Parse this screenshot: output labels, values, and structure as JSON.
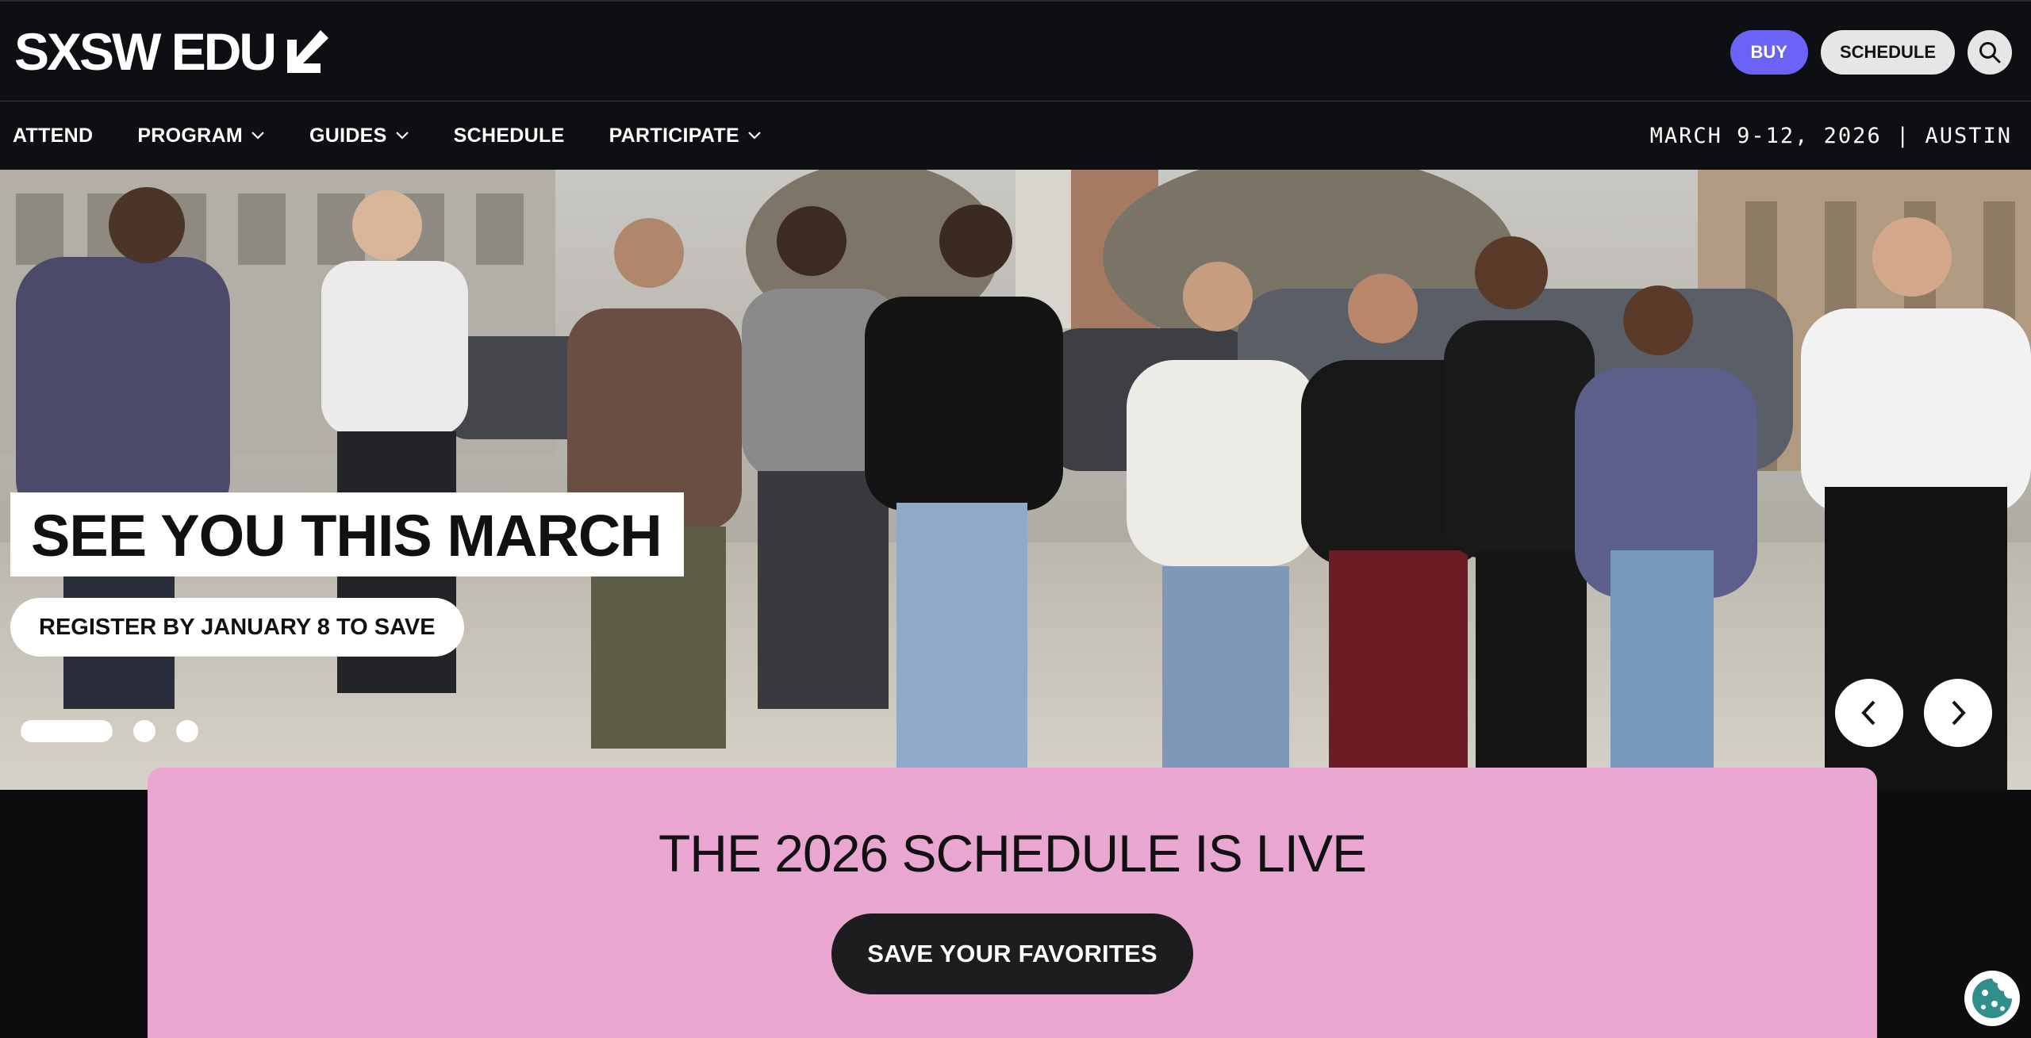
{
  "header": {
    "logo_text": "SXSW EDU",
    "buy_label": "BUY",
    "schedule_label": "SCHEDULE",
    "search_icon": "search-icon"
  },
  "nav": {
    "items": [
      {
        "label": "ATTEND",
        "has_dropdown": false
      },
      {
        "label": "PROGRAM",
        "has_dropdown": true
      },
      {
        "label": "GUIDES",
        "has_dropdown": true
      },
      {
        "label": "SCHEDULE",
        "has_dropdown": false
      },
      {
        "label": "PARTICIPATE",
        "has_dropdown": true
      }
    ],
    "date_location": "MARCH 9-12, 2026 | AUSTIN"
  },
  "hero": {
    "title": "SEE YOU THIS MARCH",
    "subtitle": "REGISTER BY JANUARY 8 TO SAVE",
    "slide_count": 3,
    "active_slide": 1
  },
  "banner": {
    "title": "THE 2026 SCHEDULE IS LIVE",
    "button_label": "SAVE YOUR FAVORITES",
    "background": "#e8a6d0"
  },
  "colors": {
    "accent": "#6b63f7",
    "dark": "#0e0f12"
  }
}
